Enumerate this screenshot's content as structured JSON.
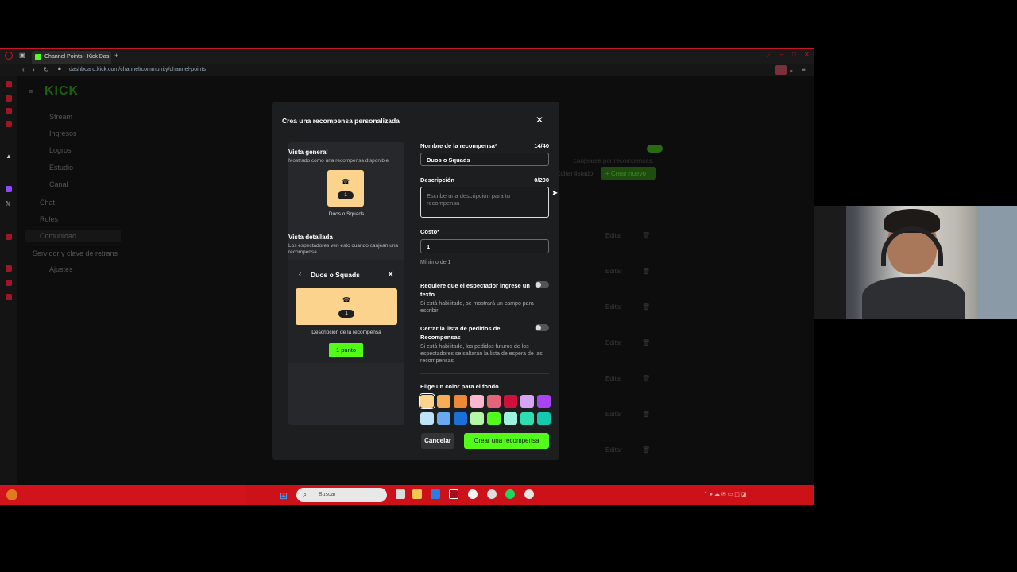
{
  "browser": {
    "tab_title": "Channel Points - Kick Das",
    "url": "dashboard.kick.com/channel/community/channel-points"
  },
  "dashboard": {
    "logo": "KICK",
    "nav": [
      {
        "label": "Stream"
      },
      {
        "label": "Ingresos"
      },
      {
        "label": "Logros"
      },
      {
        "label": "Estudio"
      },
      {
        "label": "Canal"
      }
    ],
    "canal_sub": [
      {
        "label": "Chat"
      },
      {
        "label": "Roles"
      },
      {
        "label": "Comunidad"
      }
    ],
    "servidor": "Servidor y clave de retrans",
    "ajustes": "Ajustes",
    "hint": "canjearse por recompensas.",
    "editar_listado": "Editar listado",
    "crear_nuevo": "+ Crear nuevo",
    "edit_label": "Editar"
  },
  "modal": {
    "title": "Crea una recompensa personalizada",
    "preview": {
      "overview_heading": "Vista general",
      "overview_sub": "Mostrado como una recompensa disponible",
      "reward_cost": "1",
      "reward_name": "Duos o Squads",
      "detail_heading": "Vista detallada",
      "detail_sub": "Los espectadores ven esto cuando canjean una recompensa",
      "detail_title": "Duos o Squads",
      "detail_description": "Descripción de la recompensa",
      "detail_points": "1 punto"
    },
    "form": {
      "name_label": "Nombre de la recompensa*",
      "name_counter": "14/40",
      "name_value": "Duos o Squads",
      "desc_label": "Descripción",
      "desc_counter": "0/200",
      "desc_placeholder": "Escribe una descripción para tu recompensa",
      "cost_label": "Costo*",
      "cost_value": "1",
      "cost_hint": "Mínimo de 1",
      "require_text_label": "Requiere que el espectador ingrese un texto",
      "require_text_hint": "Si está habilitado, se mostrará un campo para escribir",
      "skip_queue_label": "Cerrar la lista de pedidos de Recompensas",
      "skip_queue_hint": "Si está habilitado, los pedidos futuros de los espectadores se saltarán la lista de espera de las recompensas",
      "color_label": "Elige un color para el fondo",
      "colors_row1": [
        "#fbd38d",
        "#f6ad55",
        "#ed8936",
        "#fbb6ce",
        "#e5647a",
        "#d0103a",
        "#d6a4f5",
        "#a845f0"
      ],
      "colors_row2": [
        "#bee3f8",
        "#6aa8f0",
        "#1a6fd8",
        "#b4f7a6",
        "#53fc18",
        "#9ef0e0",
        "#2ddfb0",
        "#13c9b0"
      ],
      "selected_color": "#fbd38d"
    },
    "cancel_label": "Cancelar",
    "create_label": "Crear una recompensa"
  },
  "taskbar": {
    "search_placeholder": "Buscar"
  }
}
